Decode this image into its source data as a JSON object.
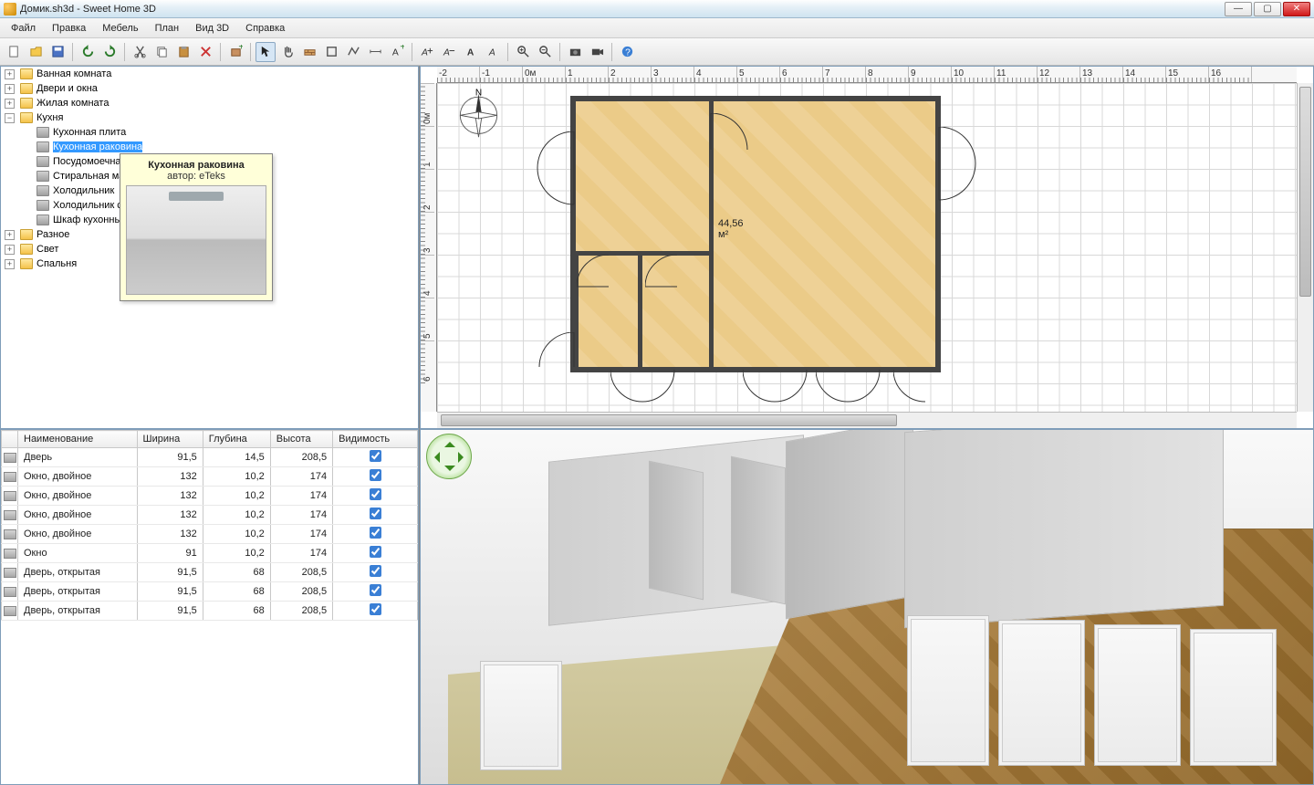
{
  "window": {
    "title": "Домик.sh3d - Sweet Home 3D"
  },
  "menubar": [
    "Файл",
    "Правка",
    "Мебель",
    "План",
    "Вид 3D",
    "Справка"
  ],
  "catalog": {
    "folders": [
      {
        "label": "Ванная комната",
        "expanded": false
      },
      {
        "label": "Двери и окна",
        "expanded": false
      },
      {
        "label": "Жилая комната",
        "expanded": false
      },
      {
        "label": "Кухня",
        "expanded": true,
        "items": [
          "Кухонная плита",
          "Кухонная раковина",
          "Посудомоечная машина",
          "Стиральная машина",
          "Холодильник",
          "Холодильник с морозильником",
          "Шкаф кухонный"
        ],
        "selected_index": 1
      },
      {
        "label": "Разное",
        "expanded": false
      },
      {
        "label": "Свет",
        "expanded": false
      },
      {
        "label": "Спальня",
        "expanded": false
      }
    ]
  },
  "preview": {
    "title": "Кухонная раковина",
    "author": "автор: eTeks"
  },
  "furniture_table": {
    "columns": [
      "Наименование",
      "Ширина",
      "Глубина",
      "Высота",
      "Видимость"
    ],
    "rows": [
      {
        "name": "Дверь",
        "width": "91,5",
        "depth": "14,5",
        "height": "208,5",
        "visible": true
      },
      {
        "name": "Окно, двойное",
        "width": "132",
        "depth": "10,2",
        "height": "174",
        "visible": true
      },
      {
        "name": "Окно, двойное",
        "width": "132",
        "depth": "10,2",
        "height": "174",
        "visible": true
      },
      {
        "name": "Окно, двойное",
        "width": "132",
        "depth": "10,2",
        "height": "174",
        "visible": true
      },
      {
        "name": "Окно, двойное",
        "width": "132",
        "depth": "10,2",
        "height": "174",
        "visible": true
      },
      {
        "name": "Окно",
        "width": "91",
        "depth": "10,2",
        "height": "174",
        "visible": true
      },
      {
        "name": "Дверь, открытая",
        "width": "91,5",
        "depth": "68",
        "height": "208,5",
        "visible": true
      },
      {
        "name": "Дверь, открытая",
        "width": "91,5",
        "depth": "68",
        "height": "208,5",
        "visible": true
      },
      {
        "name": "Дверь, открытая",
        "width": "91,5",
        "depth": "68",
        "height": "208,5",
        "visible": true
      }
    ]
  },
  "plan": {
    "h_ticks": [
      "-2",
      "-1",
      "0м",
      "1",
      "2",
      "3",
      "4",
      "5",
      "6",
      "7",
      "8",
      "9",
      "10",
      "11",
      "12",
      "13",
      "14",
      "15",
      "16"
    ],
    "v_ticks": [
      "0м",
      "1",
      "2",
      "3",
      "4",
      "5",
      "6"
    ],
    "room_area": "44,56 м²"
  }
}
